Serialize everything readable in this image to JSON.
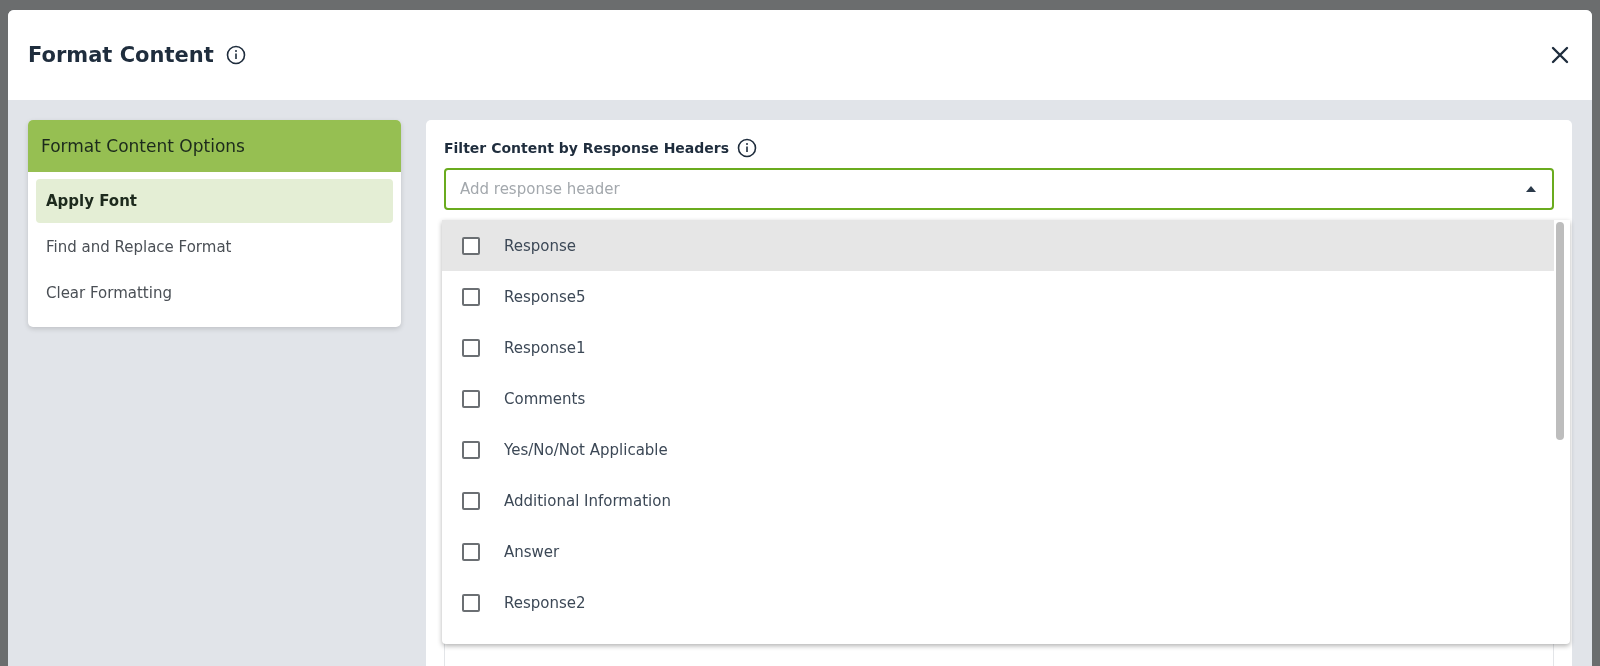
{
  "dialog": {
    "title": "Format Content"
  },
  "options_panel": {
    "title": "Format Content Options",
    "items": [
      {
        "label": "Apply Font",
        "selected": true
      },
      {
        "label": "Find and Replace Format",
        "selected": false
      },
      {
        "label": "Clear Formatting",
        "selected": false
      }
    ]
  },
  "filter": {
    "label": "Filter Content by Response Headers",
    "placeholder": "Add response header",
    "expanded": true,
    "options": [
      {
        "label": "Response",
        "checked": false,
        "hovered": true
      },
      {
        "label": "Response5",
        "checked": false,
        "hovered": false
      },
      {
        "label": "Response1",
        "checked": false,
        "hovered": false
      },
      {
        "label": "Comments",
        "checked": false,
        "hovered": false
      },
      {
        "label": "Yes/No/Not Applicable",
        "checked": false,
        "hovered": false
      },
      {
        "label": "Additional Information",
        "checked": false,
        "hovered": false
      },
      {
        "label": "Answer",
        "checked": false,
        "hovered": false
      },
      {
        "label": "Response2",
        "checked": false,
        "hovered": false
      }
    ]
  }
}
